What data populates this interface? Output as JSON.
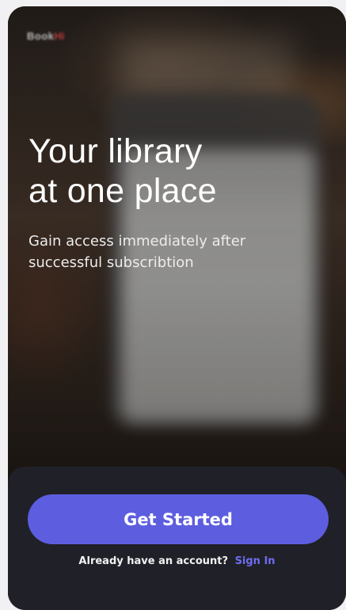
{
  "app": {
    "logo_main": "Book",
    "logo_accent": "Hi"
  },
  "hero": {
    "headline_line1": "Your library",
    "headline_line2": "at one place",
    "subtitle_line1": "Gain access immediately after",
    "subtitle_line2": "successful subscribtion"
  },
  "actions": {
    "get_started_label": "Get Started",
    "account_prompt": "Already have an account?",
    "sign_in_label": "Sign In"
  },
  "colors": {
    "accent": "#5d5de0",
    "link": "#6e6df0",
    "panel": "#202028"
  }
}
